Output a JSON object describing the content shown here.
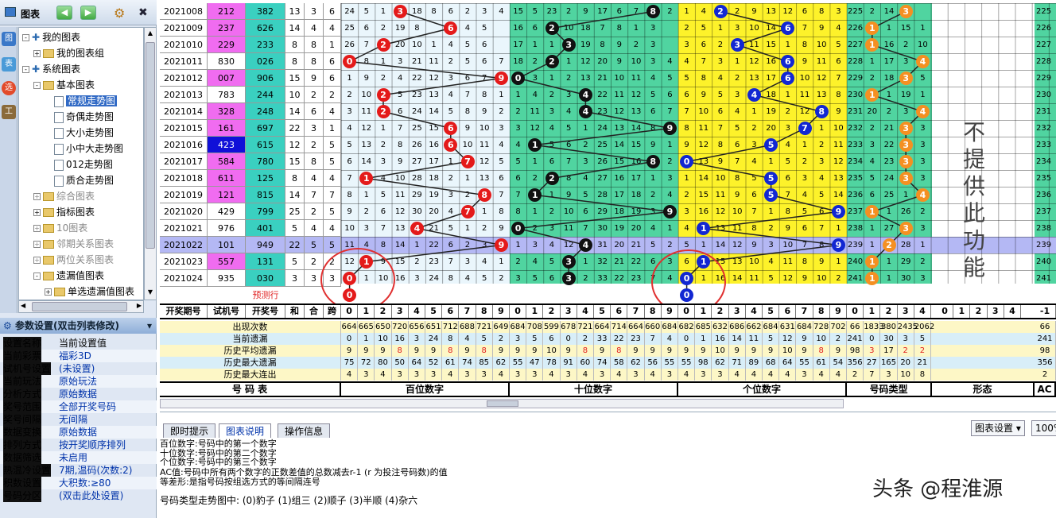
{
  "toolbar": {
    "title": "图表",
    "back": "◀",
    "fwd": "▶",
    "gear": "⚙",
    "close": "✖"
  },
  "sidebar_icons": [
    "图",
    "表",
    "选",
    "工"
  ],
  "tree": [
    {
      "label": "我的图表",
      "depth": 0,
      "pm": "-",
      "type": "root"
    },
    {
      "label": "我的图表组",
      "depth": 1,
      "pm": "+",
      "type": "folder"
    },
    {
      "label": "系统图表",
      "depth": 0,
      "pm": "-",
      "type": "root"
    },
    {
      "label": "基本图表",
      "depth": 1,
      "pm": "-",
      "type": "folder"
    },
    {
      "label": "常规走势图",
      "depth": 2,
      "type": "doc",
      "sel": true
    },
    {
      "label": "奇偶走势图",
      "depth": 2,
      "type": "doc"
    },
    {
      "label": "大小走势图",
      "depth": 2,
      "type": "doc"
    },
    {
      "label": "小中大走势图",
      "depth": 2,
      "type": "doc"
    },
    {
      "label": "012走势图",
      "depth": 2,
      "type": "doc"
    },
    {
      "label": "质合走势图",
      "depth": 2,
      "type": "doc"
    },
    {
      "label": "综合图表",
      "depth": 1,
      "pm": "+",
      "type": "folder",
      "gray": true
    },
    {
      "label": "指标图表",
      "depth": 1,
      "pm": "+",
      "type": "folder"
    },
    {
      "label": "10图表",
      "depth": 1,
      "pm": "+",
      "type": "folder",
      "gray": true
    },
    {
      "label": "邻期关系图表",
      "depth": 1,
      "pm": "+",
      "type": "folder",
      "gray": true
    },
    {
      "label": "两位关系图表",
      "depth": 1,
      "pm": "+",
      "type": "folder",
      "gray": true
    },
    {
      "label": "遗漏值图表",
      "depth": 1,
      "pm": "-",
      "type": "folder"
    },
    {
      "label": "单选遗漏值图表",
      "depth": 2,
      "pm": "+",
      "type": "folder"
    }
  ],
  "params_title": "参数设置(双击列表修改)",
  "params": [
    [
      "设置名称",
      "当前设置值"
    ],
    [
      "当前彩票",
      "福彩3D"
    ],
    [
      "试机号设置",
      "(未设置)"
    ],
    [
      "当前玩法",
      "原始玩法"
    ],
    [
      "分析方式",
      "原始数据"
    ],
    [
      "奖号范围",
      "全部开奖号码"
    ],
    [
      "奖号间隔",
      "无间隔"
    ],
    [
      "数据变换",
      "原始数据"
    ],
    [
      "排列方式",
      "按开奖顺序排列"
    ],
    [
      "数据筛选",
      "未启用"
    ],
    [
      "热温冷设置",
      "7期,温码(次数:2)"
    ],
    [
      "积数设置",
      "大积数:≥80"
    ],
    [
      "号码分区",
      "(双击此处设置)"
    ]
  ],
  "rows": [
    {
      "p": "2021008",
      "t": "212",
      "k": "382",
      "s": "13",
      "kd": "3",
      "y": "6",
      "h": [
        24,
        5,
        1,
        null,
        18,
        8,
        6,
        2,
        3,
        4
      ],
      "ht": 3,
      "tt": 8,
      "ht2": 2,
      "tm": [
        15,
        5,
        23,
        2,
        9,
        17,
        6,
        7,
        null,
        2
      ],
      "gm": [
        1,
        4,
        null,
        2,
        9,
        13,
        12,
        6,
        8,
        3
      ],
      "lt": [
        225,
        2,
        14,
        null,
        8
      ]
    },
    {
      "p": "2021009",
      "t": "237",
      "k": "626",
      "s": "14",
      "kd": "4",
      "y": "4",
      "h": [
        25,
        6,
        2,
        19,
        8,
        null,
        3,
        4,
        5
      ],
      "ht": 6,
      "tt": 2,
      "ht2": 6,
      "tm": [
        16,
        6,
        null,
        10,
        18,
        7,
        8,
        1,
        3
      ],
      "gm": [
        2,
        5,
        1,
        3,
        10,
        14,
        null,
        7,
        9,
        4
      ],
      "lt": [
        226,
        1,
        15,
        1,
        9
      ]
    },
    {
      "p": "2021010",
      "t": "229",
      "k": "233",
      "s": "8",
      "kd": "8",
      "y": "1",
      "h": [
        26,
        7,
        null,
        20,
        10,
        1,
        4,
        5,
        6
      ],
      "ht": 2,
      "tt": 3,
      "ht2": 3,
      "tm": [
        17,
        1,
        1,
        11,
        19,
        8,
        9,
        2,
        3
      ],
      "gm": [
        3,
        6,
        2,
        null,
        11,
        15,
        1,
        8,
        10,
        5
      ],
      "lt": [
        227,
        16,
        2,
        10
      ]
    },
    {
      "p": "2021011",
      "t": "830",
      "k": "026",
      "s": "8",
      "kd": "8",
      "y": "6",
      "h": [
        null,
        8,
        1,
        3,
        21,
        11,
        2,
        5,
        6,
        7
      ],
      "ht": 0,
      "tt": 2,
      "ht2": 6,
      "tm": [
        18,
        2,
        null,
        1,
        12,
        20,
        9,
        10,
        3,
        4
      ],
      "gm": [
        4,
        7,
        3,
        1,
        12,
        16,
        null,
        9,
        11,
        6
      ],
      "lt": [
        228,
        1,
        17,
        3
      ]
    },
    {
      "p": "2021012",
      "t": "007",
      "k": "906",
      "s": "15",
      "kd": "9",
      "y": "6",
      "h": [
        1,
        9,
        2,
        4,
        22,
        12,
        3,
        6,
        7,
        null
      ],
      "ht": 9,
      "tt": 0,
      "ht2": 6,
      "tm": [
        null,
        3,
        1,
        2,
        13,
        21,
        10,
        11,
        4,
        5
      ],
      "gm": [
        5,
        8,
        4,
        2,
        13,
        17,
        null,
        10,
        12,
        7
      ],
      "lt": [
        229,
        2,
        18,
        5
      ]
    },
    {
      "p": "2021013",
      "t": "783",
      "k": "244",
      "s": "10",
      "kd": "2",
      "y": "2",
      "h": [
        2,
        10,
        null,
        5,
        23,
        13,
        4,
        7,
        8,
        1
      ],
      "ht": 2,
      "tt": 4,
      "ht2": 4,
      "tm": [
        1,
        4,
        2,
        3,
        null,
        22,
        11,
        12,
        5,
        6
      ],
      "gm": [
        6,
        9,
        5,
        3,
        null,
        18,
        1,
        11,
        13,
        8
      ],
      "lt": [
        230,
        1,
        19,
        1,
        2
      ]
    },
    {
      "p": "2021014",
      "t": "328",
      "k": "248",
      "s": "14",
      "kd": "6",
      "y": "4",
      "h": [
        3,
        11,
        null,
        6,
        24,
        14,
        5,
        8,
        9,
        2
      ],
      "ht": 2,
      "tt": 4,
      "ht2": 8,
      "tm": [
        2,
        11,
        3,
        4,
        null,
        23,
        12,
        13,
        6,
        7
      ],
      "gm": [
        7,
        10,
        6,
        4,
        1,
        19,
        2,
        12,
        null,
        9
      ],
      "lt": [
        231,
        20,
        2,
        3
      ]
    },
    {
      "p": "2021015",
      "t": "161",
      "k": "697",
      "s": "22",
      "kd": "3",
      "y": "1",
      "h": [
        4,
        12,
        1,
        7,
        25,
        15,
        null,
        9,
        10,
        3
      ],
      "ht": 6,
      "tt": 9,
      "ht2": 7,
      "tm": [
        3,
        12,
        4,
        5,
        1,
        24,
        13,
        14,
        8,
        null
      ],
      "gm": [
        8,
        11,
        7,
        5,
        2,
        20,
        3,
        null,
        1,
        10
      ],
      "lt": [
        232,
        2,
        21,
        3
      ]
    },
    {
      "p": "2021016",
      "t": "423",
      "k": "615",
      "s": "12",
      "kd": "2",
      "y": "5",
      "h": [
        5,
        13,
        2,
        8,
        26,
        16,
        null,
        10,
        11,
        4
      ],
      "ht": 6,
      "tt": 1,
      "ht2": 5,
      "tm": [
        4,
        null,
        5,
        6,
        2,
        25,
        14,
        15,
        9,
        1
      ],
      "gm": [
        9,
        12,
        8,
        6,
        3,
        null,
        4,
        1,
        2,
        11
      ],
      "lt": [
        233,
        3,
        22,
        3
      ]
    },
    {
      "p": "2021017",
      "t": "584",
      "k": "780",
      "s": "15",
      "kd": "8",
      "y": "5",
      "h": [
        6,
        14,
        3,
        9,
        27,
        17,
        1,
        null,
        12,
        5
      ],
      "ht": 7,
      "tt": 8,
      "ht2": 0,
      "tm": [
        5,
        1,
        6,
        7,
        3,
        26,
        15,
        16,
        null,
        2
      ],
      "gm": [
        null,
        13,
        9,
        7,
        4,
        1,
        5,
        2,
        3,
        12
      ],
      "lt": [
        234,
        4,
        23,
        3
      ]
    },
    {
      "p": "2021018",
      "t": "611",
      "k": "125",
      "s": "8",
      "kd": "4",
      "y": "4",
      "h": [
        7,
        null,
        4,
        10,
        28,
        18,
        2,
        1,
        13,
        6
      ],
      "ht": 1,
      "tt": 2,
      "ht2": 5,
      "tm": [
        6,
        2,
        null,
        8,
        4,
        27,
        16,
        17,
        1,
        3
      ],
      "gm": [
        1,
        14,
        10,
        8,
        5,
        null,
        6,
        3,
        4,
        13
      ],
      "lt": [
        235,
        5,
        24,
        3
      ]
    },
    {
      "p": "2021019",
      "t": "121",
      "k": "815",
      "s": "14",
      "kd": "7",
      "y": "7",
      "h": [
        8,
        1,
        5,
        11,
        29,
        19,
        3,
        2,
        null,
        7
      ],
      "ht": 8,
      "tt": 1,
      "ht2": 5,
      "tm": [
        7,
        null,
        1,
        9,
        5,
        28,
        17,
        18,
        2,
        4
      ],
      "gm": [
        2,
        15,
        11,
        9,
        6,
        null,
        7,
        4,
        5,
        14
      ],
      "lt": [
        236,
        6,
        25,
        1
      ]
    },
    {
      "p": "2021020",
      "t": "429",
      "k": "799",
      "s": "25",
      "kd": "2",
      "y": "5",
      "h": [
        9,
        2,
        6,
        12,
        30,
        20,
        4,
        null,
        1,
        8
      ],
      "ht": 7,
      "tt": 9,
      "ht2": 9,
      "tm": [
        8,
        1,
        2,
        10,
        6,
        29,
        18,
        19,
        3,
        null
      ],
      "gm": [
        3,
        16,
        12,
        10,
        7,
        1,
        8,
        5,
        6,
        null
      ],
      "lt": [
        237,
        1,
        26,
        2
      ]
    },
    {
      "p": "2021021",
      "t": "976",
      "k": "401",
      "s": "5",
      "kd": "4",
      "y": "4",
      "h": [
        10,
        3,
        7,
        13,
        null,
        21,
        5,
        1,
        2,
        9
      ],
      "ht": 4,
      "tt": 0,
      "ht2": 1,
      "tm": [
        null,
        2,
        3,
        11,
        7,
        30,
        19,
        20,
        4,
        1
      ],
      "gm": [
        4,
        null,
        13,
        11,
        8,
        2,
        9,
        6,
        7,
        1
      ],
      "lt": [
        238,
        1,
        27,
        3
      ]
    },
    {
      "p": "2021022",
      "t": "101",
      "k": "949",
      "s": "22",
      "kd": "5",
      "y": "5",
      "h": [
        11,
        4,
        8,
        14,
        1,
        22,
        6,
        2,
        3,
        null
      ],
      "ht": 9,
      "tt": 4,
      "ht2": 9,
      "tm": [
        1,
        3,
        4,
        12,
        null,
        31,
        20,
        21,
        5,
        2
      ],
      "gm": [
        5,
        1,
        14,
        12,
        9,
        3,
        10,
        7,
        8,
        null
      ],
      "lt": [
        239,
        1,
        28,
        1,
        3
      ],
      "pur": true
    },
    {
      "p": "2021023",
      "t": "557",
      "k": "131",
      "s": "5",
      "kd": "2",
      "y": "2",
      "h": [
        12,
        null,
        9,
        15,
        2,
        23,
        7,
        3,
        4,
        1
      ],
      "ht": 1,
      "tt": 3,
      "ht2": 1,
      "tm": [
        2,
        4,
        5,
        null,
        1,
        32,
        21,
        22,
        6,
        3
      ],
      "gm": [
        6,
        null,
        15,
        13,
        10,
        4,
        11,
        8,
        9,
        1
      ],
      "lt": [
        240,
        1,
        29,
        2,
        4
      ]
    },
    {
      "p": "2021024",
      "t": "935",
      "k": "030",
      "s": "3",
      "kd": "3",
      "y": "3",
      "h": [
        null,
        1,
        10,
        16,
        3,
        24,
        8,
        4,
        5,
        2
      ],
      "ht": 0,
      "tt": 3,
      "ht2": 0,
      "tm": [
        3,
        5,
        6,
        null,
        2,
        33,
        22,
        23,
        7,
        4
      ],
      "gm": [
        null,
        1,
        16,
        14,
        11,
        5,
        12,
        9,
        10,
        2
      ],
      "lt": [
        241,
        1,
        30,
        3,
        5
      ]
    }
  ],
  "predict": {
    "label": "预测行",
    "h": "0",
    "g": "0"
  },
  "header": {
    "p": "开奖期号",
    "t": "试机号",
    "k": "开奖号",
    "s": "和",
    "kd": "合",
    "y": "跨",
    "digits": [
      "0",
      "1",
      "2",
      "3",
      "4",
      "5",
      "6",
      "7",
      "8",
      "9"
    ],
    "types": [
      "0",
      "1",
      "2",
      "3",
      "4"
    ],
    "shape": [
      "0",
      "1",
      "2",
      "3",
      "4"
    ],
    "ac": "-1"
  },
  "stats": [
    {
      "label": "出现次数",
      "h": [
        664,
        665,
        650,
        720,
        656,
        651,
        712,
        688,
        721,
        649
      ],
      "t": [
        684,
        708,
        599,
        678,
        721,
        664,
        714,
        664,
        660,
        684
      ],
      "g": [
        682,
        685,
        632,
        686,
        662,
        684,
        631,
        684,
        728,
        702
      ],
      "ty": [
        66,
        1833,
        380,
        2435,
        2062
      ],
      "ac": "66"
    },
    {
      "label": "当前遗漏",
      "h": [
        0,
        1,
        10,
        16,
        3,
        24,
        8,
        4,
        5,
        2
      ],
      "t": [
        3,
        5,
        6,
        0,
        2,
        33,
        22,
        23,
        7,
        4
      ],
      "g": [
        0,
        1,
        16,
        14,
        11,
        5,
        12,
        9,
        10,
        2
      ],
      "ty": [
        241,
        0,
        30,
        3,
        5
      ],
      "ac": "241"
    },
    {
      "label": "历史平均遗漏",
      "h": [
        9,
        9,
        9,
        8,
        9,
        9,
        8,
        9,
        8,
        9
      ],
      "t": [
        9,
        9,
        10,
        9,
        8,
        9,
        8,
        9,
        9,
        9
      ],
      "g": [
        9,
        9,
        10,
        9,
        9,
        9,
        10,
        9,
        8,
        9
      ],
      "ty": [
        98,
        3,
        17,
        2,
        2
      ],
      "ac": "98"
    },
    {
      "label": "历史最大遗漏",
      "h": [
        75,
        72,
        80,
        50,
        64,
        52,
        61,
        74,
        85,
        62
      ],
      "t": [
        55,
        47,
        78,
        91,
        60,
        74,
        58,
        62,
        56,
        55
      ],
      "g": [
        55,
        98,
        62,
        71,
        89,
        68,
        64,
        55,
        61,
        54
      ],
      "ty": [
        356,
        27,
        165,
        20,
        21
      ],
      "ac": "356"
    },
    {
      "label": "历史最大连出",
      "h": [
        4,
        3,
        4,
        3,
        3,
        3,
        4,
        3,
        3,
        4
      ],
      "t": [
        3,
        3,
        4,
        3,
        4,
        3,
        4,
        3,
        4,
        3
      ],
      "g": [
        4,
        3,
        3,
        4,
        4,
        4,
        4,
        3,
        4,
        4
      ],
      "ty": [
        2,
        7,
        3,
        10,
        8
      ],
      "ac": "2"
    }
  ],
  "footer": {
    "a": "号  码  表",
    "b": "百位数字",
    "c": "十位数字",
    "d": "个位数字",
    "e": "号码类型",
    "f": "形态",
    "g": "AC"
  },
  "vtext": "不提供此功能",
  "tabs": [
    "即时提示",
    "图表说明",
    "操作信息"
  ],
  "chart_setting": "图表设置",
  "zoom": "100%",
  "desc": [
    "百位数字:号码中的第一个数字",
    "十位数字:号码中的第二个数字",
    "个位数字:号码中的第三个数字",
    "AC值:号码中所有两个数字的正数差值的总数减去r-1 (r 为投注号码数)的值",
    "等差形:是指号码按组选方式的等间隔连号"
  ],
  "types_line": "号码类型走势图中:   (0)豹子   (1)组三   (2)顺子   (3)半顺   (4)杂六",
  "watermark": "头条 @程淮源"
}
